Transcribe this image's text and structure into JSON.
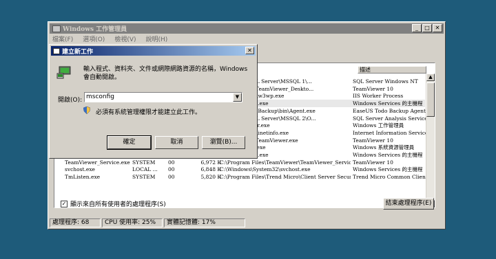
{
  "task_manager": {
    "title": "Windows 工作管理員",
    "menu": [
      "檔案(F)",
      "選項(O)",
      "檢視(V)",
      "說明(H)"
    ],
    "column_header_desc": "描述",
    "rows": [
      {
        "name": "",
        "user": "",
        "cpu": "",
        "mem": "",
        "path": "\\Microsoft SQL Server\\MSSQL 1\\...",
        "desc": "SQL Server Windows NT"
      },
      {
        "name": "",
        "user": "",
        "cpu": "",
        "mem": "",
        "path": "\\TeamViewer\\TeamViewer_Deskto...",
        "desc": "TeamViewer 10"
      },
      {
        "name": "",
        "user": "",
        "cpu": "",
        "mem": "",
        "path": "tem32\\inetsrv\\w3wp.exe",
        "desc": "IIS Worker Process"
      },
      {
        "name": "",
        "user": "",
        "cpu": "",
        "mem": "",
        "path": "tem32\\svchost.exe",
        "desc": "Windows Services 的主機程"
      },
      {
        "name": "",
        "user": "",
        "cpu": "",
        "mem": "",
        "path": "\\EaseUS\\Todo Backup\\bin\\Agent.exe",
        "desc": "EaseUS Todo Backup Agent A"
      },
      {
        "name": "",
        "user": "",
        "cpu": "",
        "mem": "",
        "path": "\\Microsoft SQL Server\\MSSQL 2\\O...",
        "desc": "SQL Server Analysis Service"
      },
      {
        "name": "",
        "user": "",
        "cpu": "",
        "mem": "",
        "path": "tem32\\taskmgr.exe",
        "desc": "Windows 工作管理員"
      },
      {
        "name": "",
        "user": "",
        "cpu": "",
        "mem": "",
        "path": "tem32\\inetsrv\\inetinfo.exe",
        "desc": "Internet Information Services"
      },
      {
        "name": "",
        "user": "",
        "cpu": "",
        "mem": "",
        "path": "\\TeamViewer\\TeamViewer.exe",
        "desc": "TeamViewer 10"
      },
      {
        "name": "",
        "user": "",
        "cpu": "",
        "mem": "",
        "path": "tem32\\wsmm.exe",
        "desc": "Windows 系統資源管理員"
      },
      {
        "name": "",
        "user": "",
        "cpu": "",
        "mem": "",
        "path": "tem32\\svchost.exe",
        "desc": "Windows Services 的主機程"
      },
      {
        "name": "TeamViewer_Service.exe",
        "user": "SYSTEM",
        "cpu": "00",
        "mem": "6,972 K",
        "path": "C:\\Program Files\\TeamViewer\\TeamViewer_Service...",
        "desc": "TeamViewer 10"
      },
      {
        "name": "svchost.exe",
        "user": "LOCAL ...",
        "cpu": "00",
        "mem": "6,848 K",
        "path": "C:\\Windows\\System32\\svchost.exe",
        "desc": "Windows Services 的主機程"
      },
      {
        "name": "TmListen.exe",
        "user": "SYSTEM",
        "cpu": "00",
        "mem": "5,820 K",
        "path": "C:\\Program Files\\Trend Micro\\Client Server Securit...",
        "desc": "Trend Micro Common Client"
      }
    ],
    "show_all_label": "顯示來自所有使用者的處理程序(S)",
    "end_process_label": "結束處理程序(E)",
    "status": [
      "處理程序: 68",
      "CPU 使用率: 25%",
      "實體記憶體: 17%"
    ]
  },
  "run_dialog": {
    "title": "建立新工作",
    "description": "輸入程式、資料夾、文件或網際網路資源的名稱，Windows 會自動開啟。",
    "open_label": "開啟(O):",
    "open_value": "msconfig",
    "admin_note": "必須有系統管理權限才能建立此工作。",
    "ok_label": "確定",
    "cancel_label": "取消",
    "browse_label": "瀏覽(B)..."
  }
}
